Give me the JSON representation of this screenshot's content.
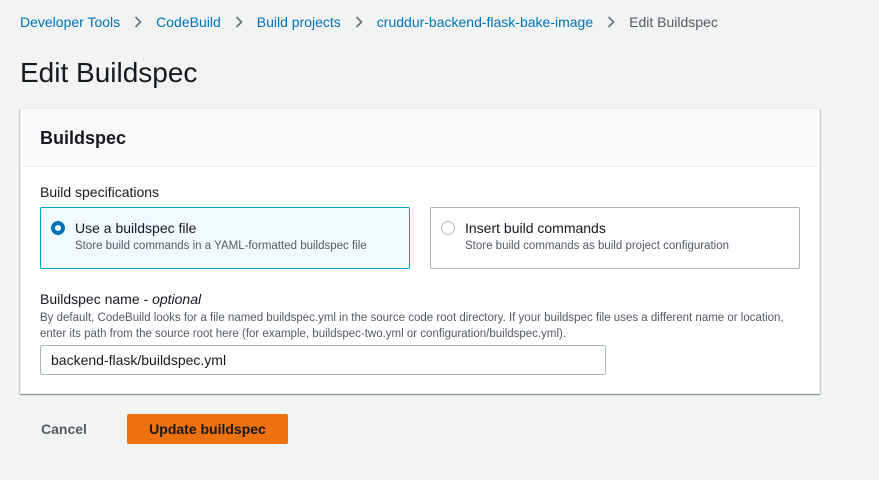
{
  "breadcrumb": {
    "items": [
      {
        "label": "Developer Tools"
      },
      {
        "label": "CodeBuild"
      },
      {
        "label": "Build projects"
      },
      {
        "label": "cruddur-backend-flask-bake-image"
      }
    ],
    "current": "Edit Buildspec"
  },
  "page": {
    "title": "Edit Buildspec"
  },
  "buildspec": {
    "header": "Buildspec",
    "spec_label": "Build specifications",
    "options": [
      {
        "title": "Use a buildspec file",
        "description": "Store build commands in a YAML-formatted buildspec file",
        "selected": true
      },
      {
        "title": "Insert build commands",
        "description": "Store build commands as build project configuration",
        "selected": false
      }
    ],
    "name_label": "Buildspec name - ",
    "name_optional": "optional",
    "name_description": "By default, CodeBuild looks for a file named buildspec.yml in the source code root directory. If your buildspec file uses a different name or location, enter its path from the source root here (for example, buildspec-two.yml or configuration/buildspec.yml).",
    "name_value": "backend-flask/buildspec.yml"
  },
  "actions": {
    "cancel": "Cancel",
    "submit": "Update buildspec"
  },
  "colors": {
    "accent": "#0073bb",
    "primary_button": "#ec7211",
    "selected_tile_bg": "#f1faff",
    "selected_tile_border": "#00a1c9"
  },
  "icons": {
    "breadcrumb_separator": "chevron-right-icon"
  }
}
